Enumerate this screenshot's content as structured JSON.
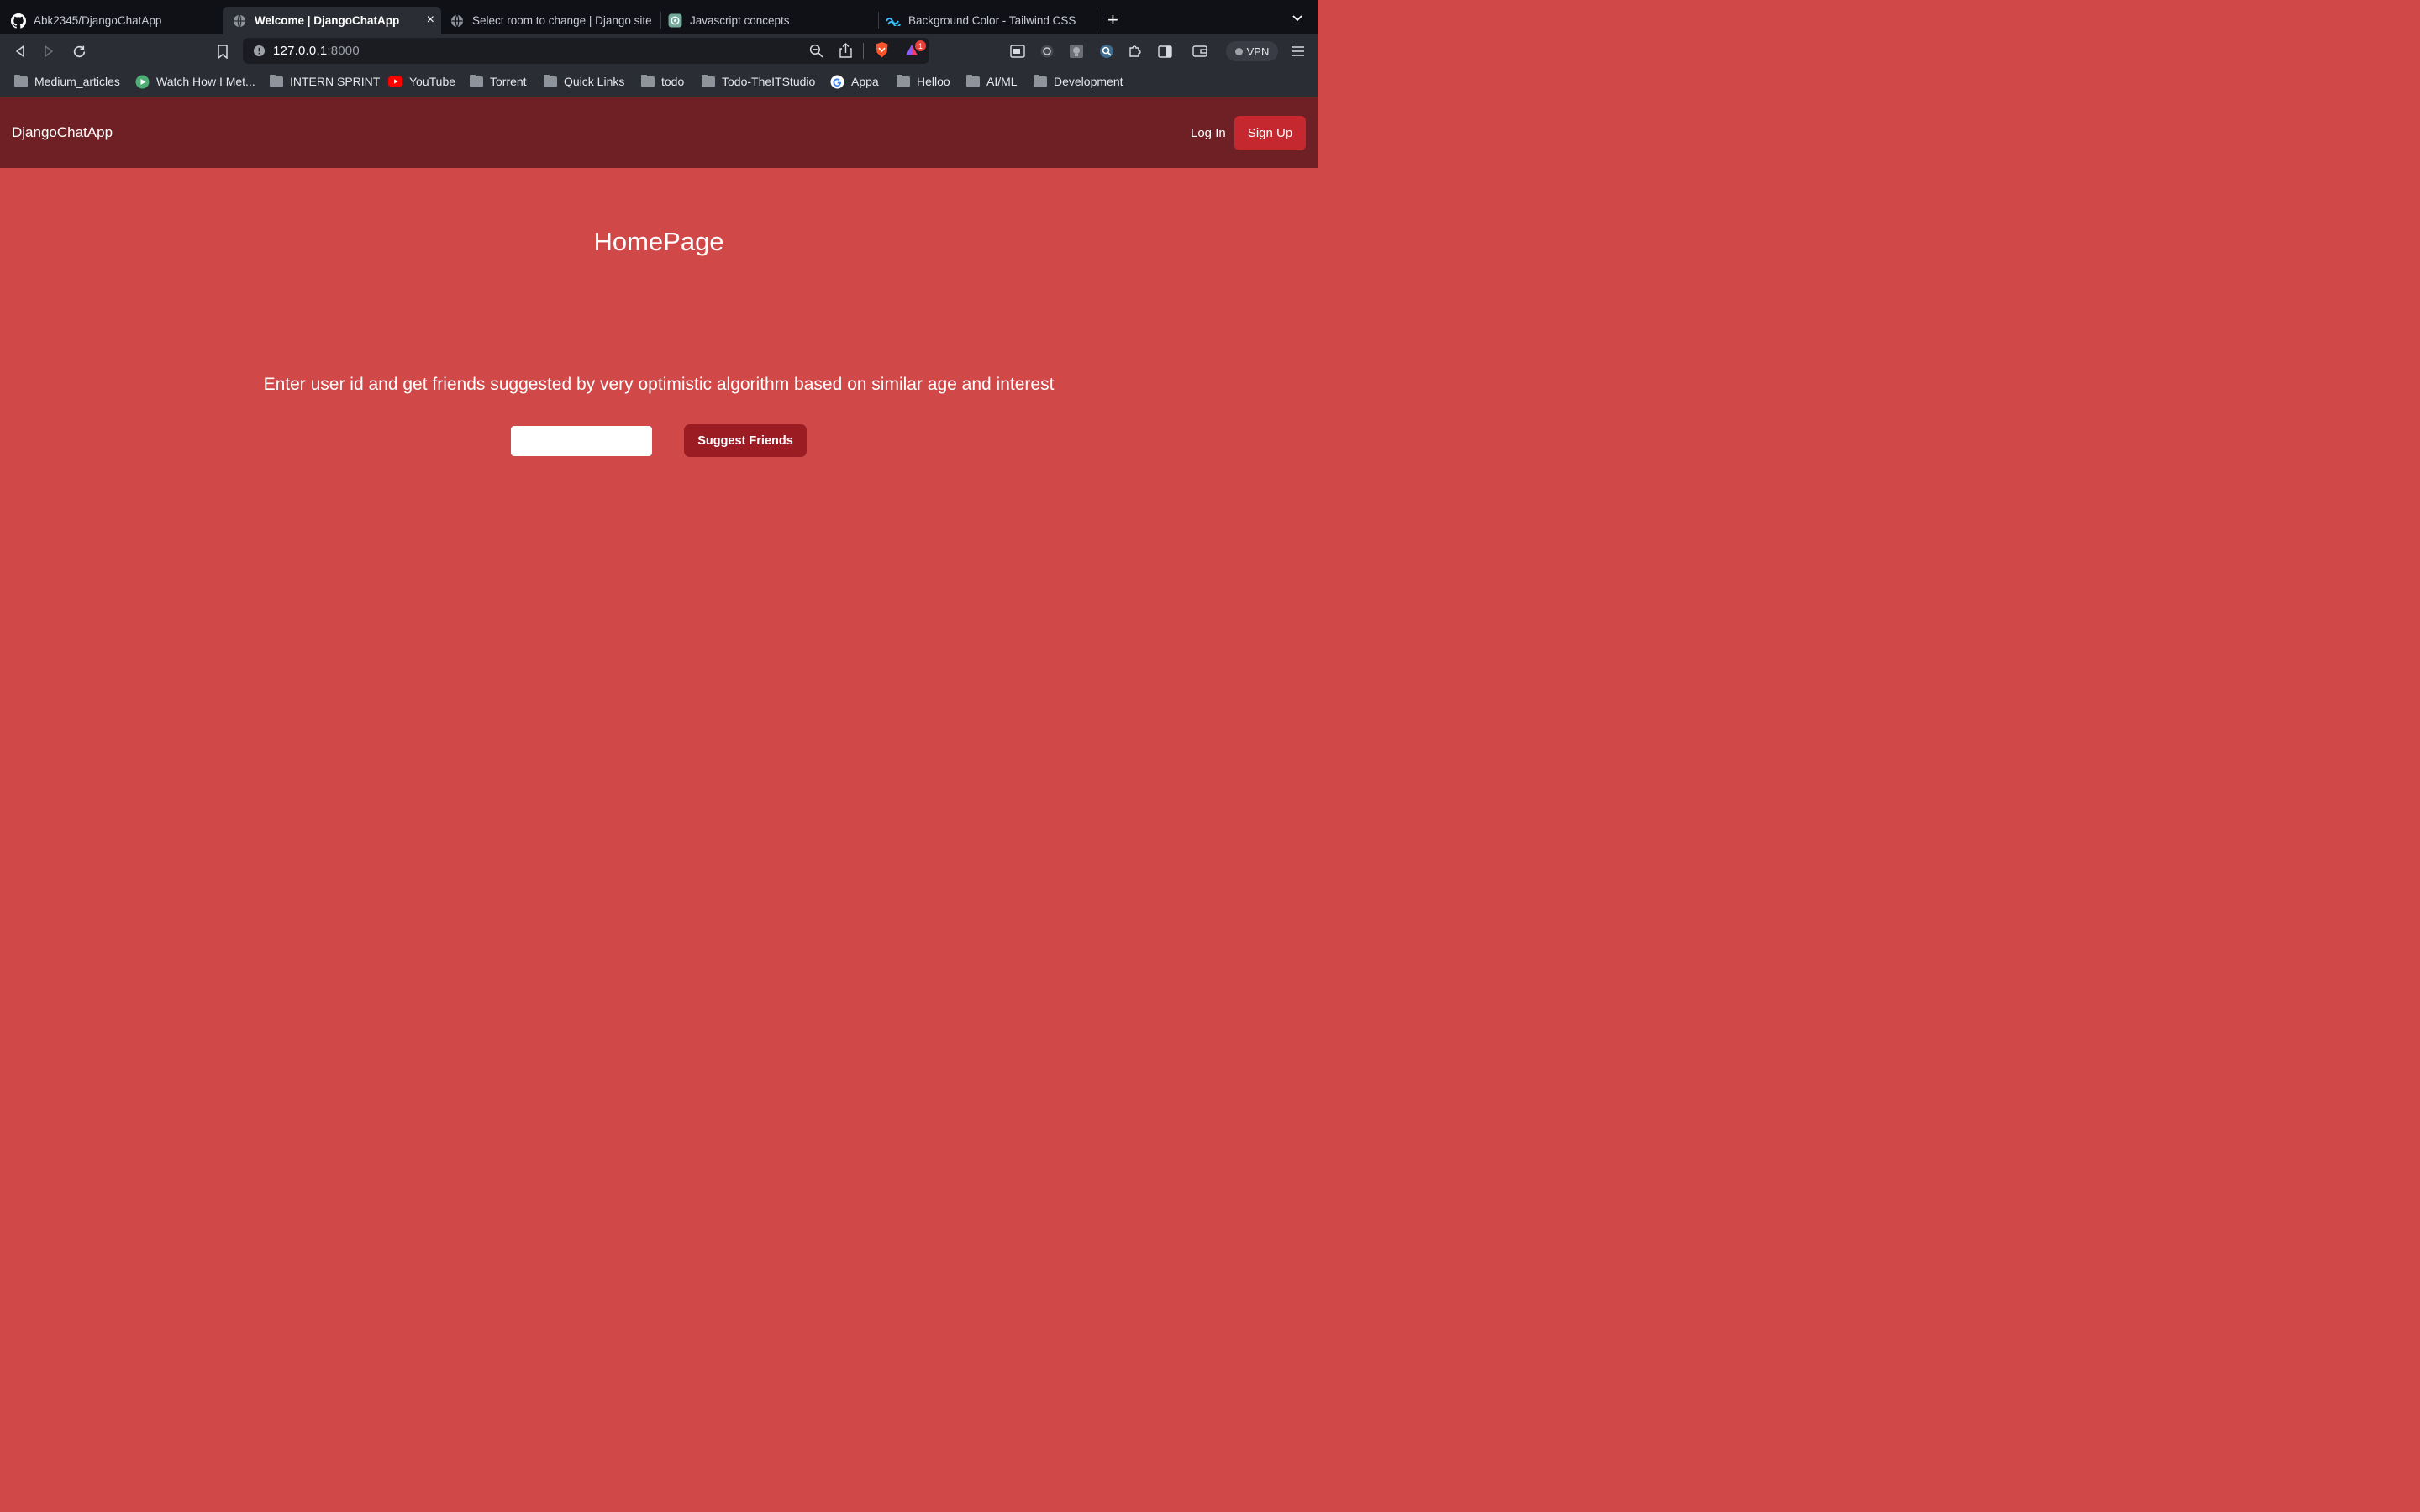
{
  "browser": {
    "tabs": [
      {
        "title": "Abk2345/DjangoChatApp",
        "icon": "github-icon",
        "active": false
      },
      {
        "title": "Welcome | DjangoChatApp",
        "icon": "globe-icon",
        "active": true
      },
      {
        "title": "Select room to change | Django site",
        "icon": "globe-icon",
        "active": false
      },
      {
        "title": "Javascript concepts",
        "icon": "chatgpt-icon",
        "active": false
      },
      {
        "title": "Background Color - Tailwind CSS",
        "icon": "tailwind-icon",
        "active": false
      }
    ],
    "close_glyph": "×",
    "new_tab_glyph": "+",
    "url_host": "127.0.0.1",
    "url_port": ":8000",
    "notification_count": "1",
    "vpn_label": "VPN"
  },
  "bookmarks": [
    {
      "label": "Medium_articles",
      "icon": "folder-icon"
    },
    {
      "label": "Watch How I Met...",
      "icon": "play-icon"
    },
    {
      "label": "INTERN SPRINT",
      "icon": "folder-icon"
    },
    {
      "label": "YouTube",
      "icon": "youtube-icon"
    },
    {
      "label": "Torrent",
      "icon": "folder-icon"
    },
    {
      "label": "Quick Links",
      "icon": "folder-icon"
    },
    {
      "label": "todo",
      "icon": "folder-icon"
    },
    {
      "label": "Todo-TheITStudio",
      "icon": "folder-icon"
    },
    {
      "label": "Appa",
      "icon": "google-icon"
    },
    {
      "label": "Helloo",
      "icon": "folder-icon"
    },
    {
      "label": "AI/ML",
      "icon": "folder-icon"
    },
    {
      "label": "Development",
      "icon": "folder-icon"
    }
  ],
  "page": {
    "brand": "DjangoChatApp",
    "login_label": "Log In",
    "signup_label": "Sign Up",
    "heading": "HomePage",
    "description": "Enter user id and get friends suggested by very optimistic algorithm based on similar age and interest",
    "user_id_value": "",
    "suggest_label": "Suggest Friends"
  },
  "colors": {
    "page_background": "#d04848",
    "navbar_background": "#6f2025",
    "signup_button": "#c5282e",
    "suggest_button": "#9b1c22",
    "browser_chrome": "#2b2d35",
    "tabstrip": "#0f1117"
  }
}
